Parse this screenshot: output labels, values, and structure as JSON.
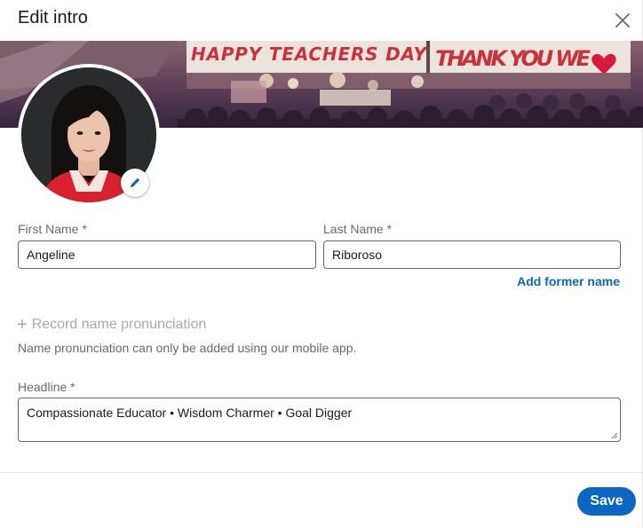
{
  "modal": {
    "title": "Edit intro",
    "close_icon": "close-icon"
  },
  "banner": {
    "text_left": "HAPPY TEACHERS DAY",
    "text_right": "THANK YOU WE",
    "heart_color": "#d81b3c"
  },
  "photo": {
    "edit_icon": "pencil-icon",
    "accent": "#0a66c2"
  },
  "form": {
    "first_name_label": "First Name *",
    "first_name_value": "Angeline",
    "last_name_label": "Last Name *",
    "last_name_value": "Riboroso",
    "add_former_name": "Add former name",
    "record_pronunciation": "Record name pronunciation",
    "pronunciation_helper": "Name pronunciation can only be added using our mobile app.",
    "headline_label": "Headline *",
    "headline_value": "Compassionate Educator • Wisdom Charmer • Goal Digger"
  },
  "footer": {
    "save_label": "Save",
    "save_color": "#0a66c2"
  }
}
